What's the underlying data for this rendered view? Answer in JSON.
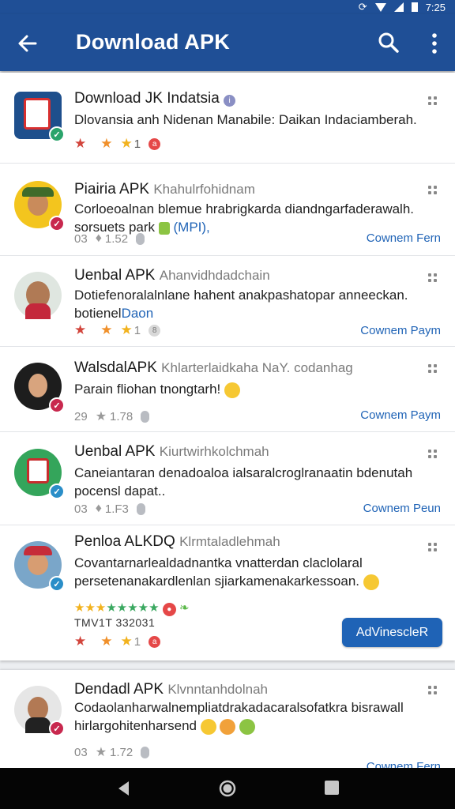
{
  "status_bar": {
    "time": "7:25"
  },
  "app_bar": {
    "title": "Download APK"
  },
  "items": [
    {
      "name": "Download JK Indatsia",
      "desc": "Dlovansia anh Nidenan Manabile: Daikan Indaciamberah.",
      "meta": "1"
    },
    {
      "name": "Piairia APK",
      "sub": "Khahulrfohidnam",
      "desc": "Corloeoalnan blemue hrabrigkarda diandngarfaderawalh.",
      "desc2": "sorsuets park",
      "desc2_link": "(MPI),",
      "meta_a": "03",
      "meta_b": "1.52",
      "right_link": "Cownem Fern"
    },
    {
      "name": "Uenbal APK",
      "sub": "Ahanvidhdadchain",
      "desc": "Dotiefenoralalnlane hahent anakpashatopar anneeckan.",
      "desc2": "botienel",
      "desc2_link": "Daon",
      "meta": "1",
      "right_link": "Cownem Paym"
    },
    {
      "name": "WalsdalAPK",
      "sub": "Khlarterlaidkaha  NaY. codanhag",
      "desc": "Parain fliohan tnongtarh!",
      "meta_a": "29",
      "meta_b": "1.78",
      "right_link": "Cownem Paym"
    },
    {
      "name": "Uenbal APK",
      "sub": "Kiurtwirhkolchmah",
      "desc": "Caneiantaran denadoaloa ialsaralcroglranaatin bdenutah",
      "desc2": "pocensl dapat..",
      "meta_a": "03",
      "meta_b": "1.F3",
      "right_link": "Cownem Peun"
    },
    {
      "name": "Penloa ALKDQ",
      "sub": "Klrmtaladlehmah",
      "desc": "Covantarnarlealdadnantka vnatterdan claclolaral",
      "desc2": "persetenanakardlenlan sjiarkamenakarkessoan.",
      "rating_text": "TMV1T 332031",
      "meta": "1",
      "button": "AdVinescleR"
    },
    {
      "name": "Dendadl APK",
      "sub": "Klvnntanhdolnah",
      "desc": "Codaolanharwalnempliatdrakadacaralsofatkra bisrawall",
      "desc2": "hirlargohitenharsend",
      "meta_a": "03",
      "meta_b": "1.72",
      "right_link": "Cownem Fern"
    }
  ],
  "colors": {
    "app_bar": "#1f4f96",
    "accent": "#1f63b6",
    "star_red": "#d2453c",
    "star_yellow": "#f2b21e"
  },
  "icons": [
    "back-arrow-icon",
    "search-icon",
    "more-vert-icon",
    "drag-handle-icon",
    "star-icon",
    "verified-badge-icon",
    "nav-back-icon",
    "nav-home-icon",
    "nav-recents-icon"
  ]
}
